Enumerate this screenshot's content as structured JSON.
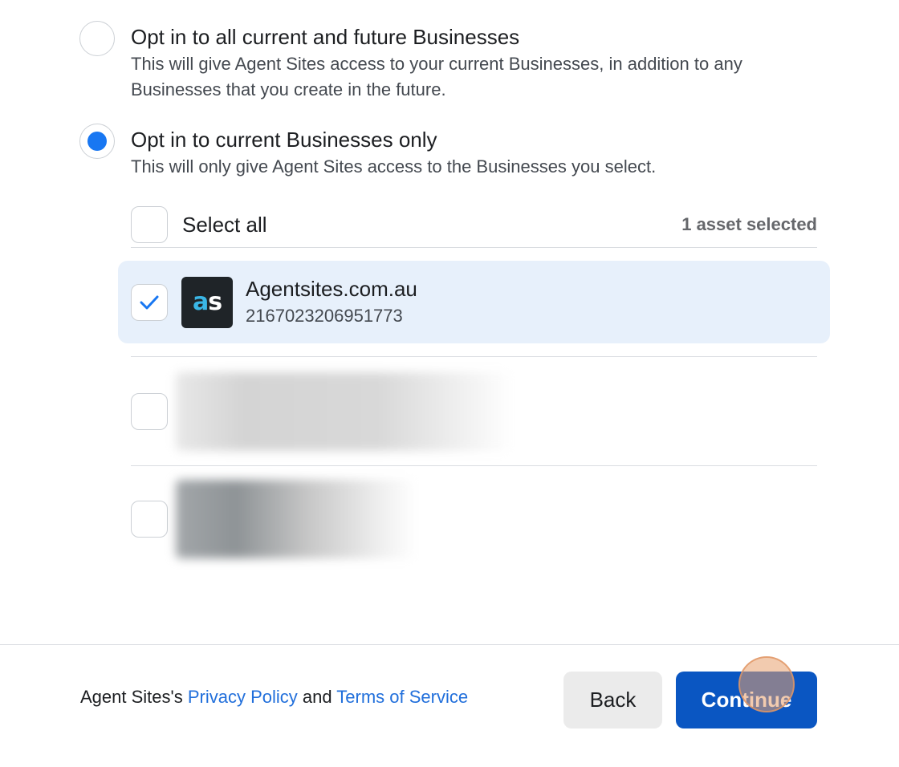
{
  "options": {
    "all": {
      "title": "Opt in to all current and future Businesses",
      "description_line1": "This will give Agent Sites access to your current Businesses, in addition to any",
      "description_line2": "Businesses that you create in the future."
    },
    "current": {
      "title": "Opt in to current Businesses only",
      "description": "This will only give Agent Sites access to the Businesses you select."
    },
    "selected": "current"
  },
  "select_all": {
    "label": "Select all",
    "count_text": "1 asset selected"
  },
  "assets": [
    {
      "name": "Agentsites.com.au",
      "id": "2167023206951773",
      "logo_text_a": "a",
      "logo_text_s": "s",
      "checked": true
    }
  ],
  "footer": {
    "prefix": "Agent Sites's ",
    "privacy_link": "Privacy Policy",
    "joiner": " and ",
    "terms_link": "Terms of Service",
    "back_label": "Back",
    "continue_label": "Continue"
  },
  "colors": {
    "accent": "#1877f2",
    "primary_button": "#0a56c2",
    "link": "#216fdb",
    "selected_row_bg": "#e7f0fb"
  }
}
